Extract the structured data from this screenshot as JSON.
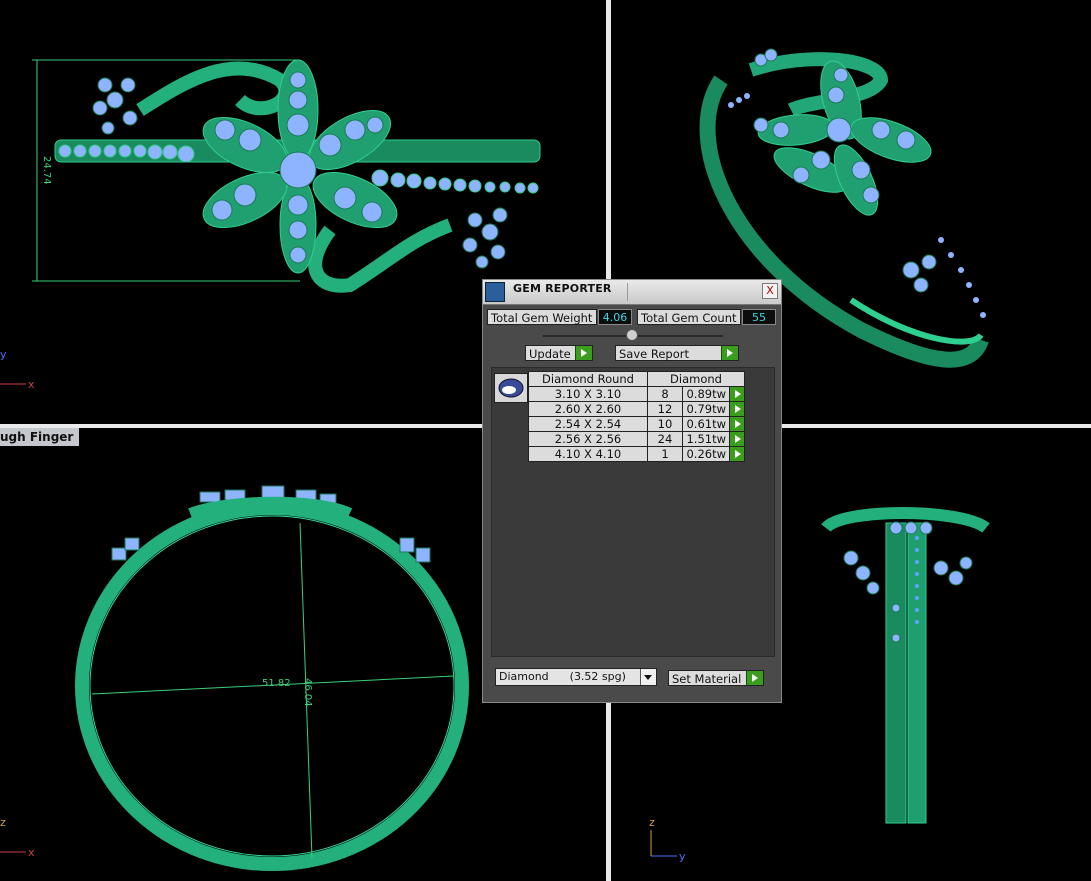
{
  "viewport": {
    "bottom_left_label": "ugh Finger",
    "dimensions": {
      "height_top": "24.74",
      "width_front": "51.82",
      "height_front": "46.04"
    },
    "axes": {
      "x": "x",
      "y": "y",
      "z": "z"
    }
  },
  "gem_reporter": {
    "title": "GEM REPORTER",
    "close_label": "X",
    "total_weight_label": "Total Gem Weight",
    "total_weight_value": "4.06",
    "total_count_label": "Total Gem Count",
    "total_count_value": "55",
    "update_label": "Update",
    "save_report_label": "Save Report",
    "table": {
      "header_shape": "Diamond Round",
      "header_material": "Diamond",
      "rows": [
        {
          "size": "3.10 X 3.10",
          "count": "8",
          "weight": "0.89tw"
        },
        {
          "size": "2.60 X 2.60",
          "count": "12",
          "weight": "0.79tw"
        },
        {
          "size": "2.54 X 2.54",
          "count": "10",
          "weight": "0.61tw"
        },
        {
          "size": "2.56 X 2.56",
          "count": "24",
          "weight": "1.51tw"
        },
        {
          "size": "4.10 X 4.10",
          "count": "1",
          "weight": "0.26tw"
        }
      ]
    },
    "material_select_value": "Diamond      (3.52 spg)",
    "set_material_label": "Set Material"
  },
  "colors": {
    "metal": "#1f9e6e",
    "gem": "#8fb4ff",
    "dimension": "#39d17a"
  }
}
